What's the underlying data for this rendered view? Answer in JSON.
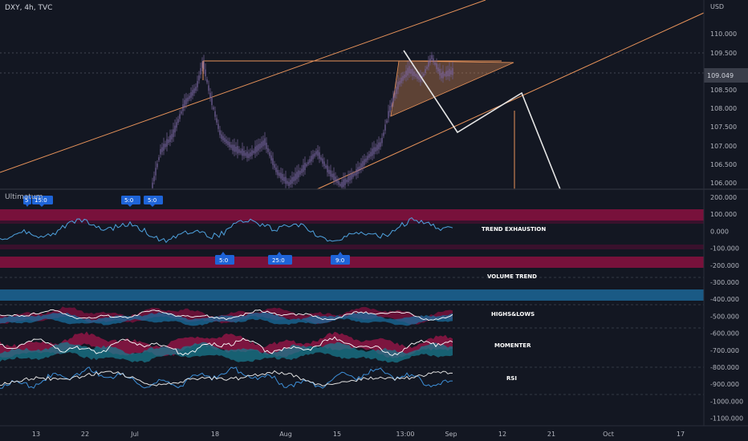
{
  "main": {
    "symbol": "DXY, 4h, TVC",
    "currency": "USD",
    "price_ticks": [
      "110.000",
      "109.500",
      "108.500",
      "108.000",
      "107.500",
      "107.000",
      "106.500",
      "106.000"
    ],
    "current_price_tag": "109.049"
  },
  "indicator": {
    "name": "Ultimatum",
    "ticks": [
      "200.000",
      "100.000",
      "0.000",
      "-100.000",
      "-200.000",
      "-300.000",
      "-400.000",
      "-500.000",
      "-600.000",
      "-700.000",
      "-800.000",
      "-900.000",
      "-1000.000",
      "-1100.000"
    ],
    "panel_labels": [
      "TREND EXHAUSTION",
      "VOLUME TREND",
      "HIGHS&LOWS",
      "MOMENTER",
      "RSI"
    ],
    "markers_top": [
      "5",
      "15:0",
      "5:0",
      "5:0"
    ],
    "markers_bottom": [
      "5:0",
      "25:0",
      "9:0"
    ]
  },
  "time_axis": [
    "13",
    "22",
    "Jul",
    "18",
    "Aug",
    "15",
    "13:00",
    "Sep",
    "12",
    "21",
    "Oct",
    "17"
  ],
  "colors": {
    "background": "#131722",
    "orange_line": "#e8935a",
    "white_line": "#e0e0e0",
    "candle": "#6b5a8a",
    "marker_blue": "#1e64d8",
    "band_red": "#b0174a",
    "band_blue": "#1a6e9e"
  }
}
